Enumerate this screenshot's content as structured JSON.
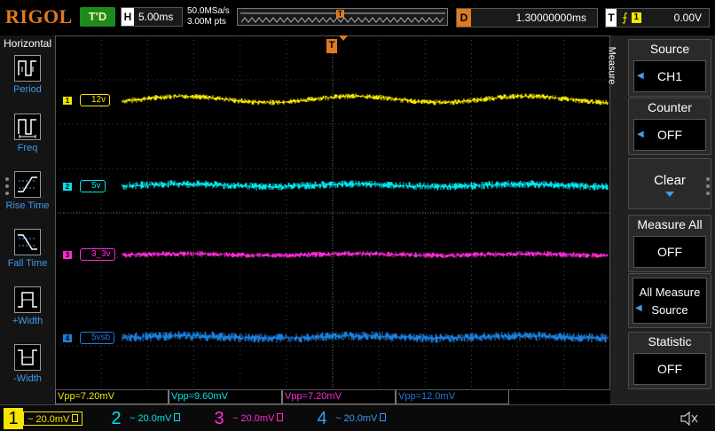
{
  "brand": "RIGOL",
  "run_state": "T'D",
  "horizontal": {
    "tag": "H",
    "timebase": "5.00ms"
  },
  "sample": {
    "rate": "50.0MSa/s",
    "points": "3.00M pts"
  },
  "memory_marker": "T",
  "delay": {
    "tag": "D",
    "value": "1.30000000ms"
  },
  "trigger": {
    "tag": "T",
    "edge": "⨍",
    "source": "1",
    "level": "0.00V"
  },
  "left_panel": {
    "title": "Horizontal",
    "buttons": [
      {
        "label": "Period",
        "icon": "period-icon"
      },
      {
        "label": "Freq",
        "icon": "freq-icon"
      },
      {
        "label": "Rise Time",
        "icon": "rise-time-icon"
      },
      {
        "label": "Fall Time",
        "icon": "fall-time-icon"
      },
      {
        "label": "+Width",
        "icon": "pos-width-icon"
      },
      {
        "label": "-Width",
        "icon": "neg-width-icon"
      }
    ]
  },
  "trigger_marker": "T",
  "channels": [
    {
      "num": "1",
      "label": "12v",
      "color": "#f5e600",
      "scale": "20.0mV"
    },
    {
      "num": "2",
      "label": "5v",
      "color": "#00e5ee",
      "scale": "20.0mV"
    },
    {
      "num": "3",
      "label": "3_3v",
      "color": "#ff2bd9",
      "scale": "20.0mV"
    },
    {
      "num": "4",
      "label": "5vsb",
      "color": "#1e7ddc",
      "scale": "20.0mV"
    }
  ],
  "measurements": [
    "Vpp=7.20mV",
    "Vpp=9.60mV",
    "Vpp=7.20mV",
    "Vpp=12.0mV"
  ],
  "menu": {
    "tab": "Measure",
    "source": {
      "title": "Source",
      "value": "CH1"
    },
    "counter": {
      "title": "Counter",
      "value": "OFF"
    },
    "clear": "Clear",
    "measure_all": {
      "title": "Measure All",
      "value": "OFF"
    },
    "all_measure_source": {
      "line1": "All Measure",
      "line2": "Source"
    },
    "statistic": {
      "title": "Statistic",
      "value": "OFF"
    }
  }
}
